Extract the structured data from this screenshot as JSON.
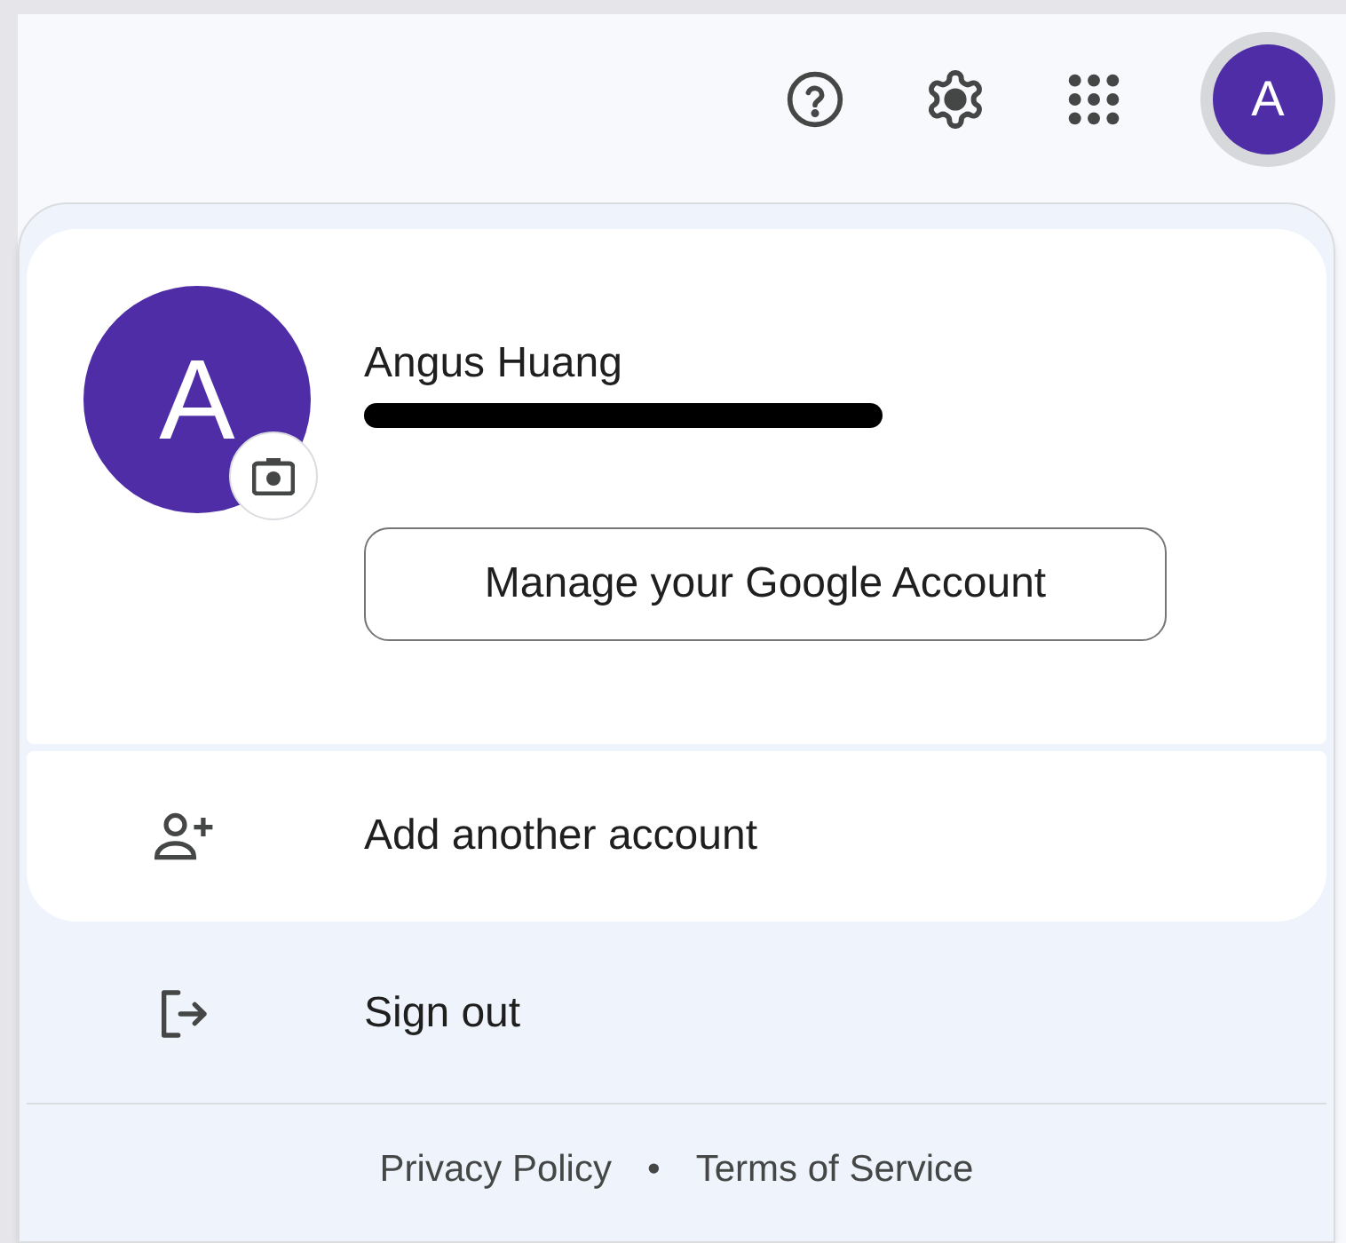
{
  "toolbar": {
    "avatar_letter": "A"
  },
  "account": {
    "avatar_letter": "A",
    "name": "Angus Huang",
    "manage_button": "Manage your Google Account"
  },
  "menu_items": [
    {
      "kind": "add-account",
      "label": "Add another account"
    },
    {
      "kind": "sign-out",
      "label": "Sign out"
    }
  ],
  "footer": {
    "links": [
      "Privacy Policy",
      "Terms of Service"
    ],
    "separator": "•"
  }
}
